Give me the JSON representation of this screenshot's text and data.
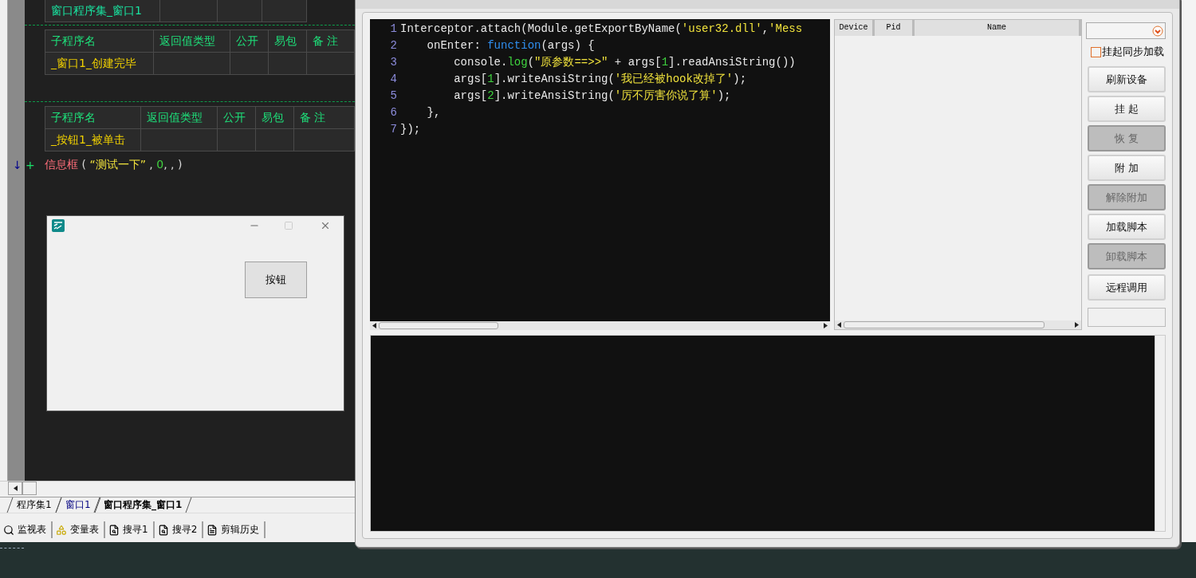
{
  "ide": {
    "module_table": {
      "name": "窗口程序集_窗口1"
    },
    "subroutines": [
      {
        "columns": [
          "子程序名",
          "返回值类型",
          "公开",
          "易包",
          "备 注"
        ],
        "name": "_窗口1_创建完毕"
      },
      {
        "columns": [
          "子程序名",
          "返回值类型",
          "公开",
          "易包",
          "备 注"
        ],
        "name": "_按钮1_被单击"
      }
    ],
    "line_marks": [
      {
        "kind": "arrow",
        "text": "↓"
      },
      {
        "kind": "plus",
        "text": "+"
      }
    ],
    "statement": [
      {
        "kind": "command",
        "text": "信息框"
      },
      {
        "kind": "punct",
        "text": " ( "
      },
      {
        "kind": "string",
        "text": "“测试一下”"
      },
      {
        "kind": "punct",
        "text": " , "
      },
      {
        "kind": "number",
        "text": "0"
      },
      {
        "kind": "punct",
        "text": ", , )"
      }
    ],
    "form_window": {
      "button": "按钮"
    },
    "doc_tabs": [
      {
        "label": "程序集1",
        "selected": false,
        "color": "#000000"
      },
      {
        "label": "窗口1",
        "selected": false,
        "color": "#000080"
      },
      {
        "label": "窗口程序集_窗口1",
        "selected": true,
        "color": "#000000"
      }
    ],
    "panel_tabs": [
      {
        "kind": "watch",
        "label": "监视表"
      },
      {
        "kind": "variables",
        "label": "变量表"
      },
      {
        "kind": "search",
        "label": "搜寻1"
      },
      {
        "kind": "search",
        "label": "搜寻2"
      },
      {
        "kind": "history",
        "label": "剪辑历史"
      }
    ]
  },
  "frida": {
    "code": [
      [
        {
          "kind": "plain",
          "text": "Interceptor.attach(Module.getExportByName("
        },
        {
          "kind": "string",
          "text": "'user32.dll'"
        },
        {
          "kind": "plain",
          "text": ","
        },
        {
          "kind": "string",
          "text": "'Mess"
        }
      ],
      [
        {
          "kind": "plain",
          "text": "    onEnter: "
        },
        {
          "kind": "keyword",
          "text": "function"
        },
        {
          "kind": "plain",
          "text": "(args) {"
        }
      ],
      [
        {
          "kind": "plain",
          "text": "        console."
        },
        {
          "kind": "call",
          "text": "log"
        },
        {
          "kind": "plain",
          "text": "("
        },
        {
          "kind": "string",
          "text": "\"原参数==>>\""
        },
        {
          "kind": "plain",
          "text": " + args["
        },
        {
          "kind": "number",
          "text": "1"
        },
        {
          "kind": "plain",
          "text": "].readAnsiString())"
        }
      ],
      [
        {
          "kind": "plain",
          "text": "        args["
        },
        {
          "kind": "number",
          "text": "1"
        },
        {
          "kind": "plain",
          "text": "].writeAnsiString("
        },
        {
          "kind": "string",
          "text": "'我已经被hook改掉了'"
        },
        {
          "kind": "plain",
          "text": ");"
        }
      ],
      [
        {
          "kind": "plain",
          "text": "        args["
        },
        {
          "kind": "number",
          "text": "2"
        },
        {
          "kind": "plain",
          "text": "].writeAnsiString("
        },
        {
          "kind": "string",
          "text": "'厉不厉害你说了算'"
        },
        {
          "kind": "plain",
          "text": ");"
        }
      ],
      [
        {
          "kind": "plain",
          "text": "    },"
        }
      ],
      [
        {
          "kind": "plain",
          "text": "});"
        }
      ]
    ],
    "line_numbers": [
      "1",
      "2",
      "3",
      "4",
      "5",
      "6",
      "7"
    ],
    "device_columns": [
      "Device",
      "Pid",
      "Name"
    ],
    "suspend_sync": {
      "label": "挂起同步加载",
      "checked": false
    },
    "buttons": [
      {
        "label": "刷新设备",
        "disabled": false
      },
      {
        "label": "挂 起",
        "disabled": false
      },
      {
        "label": "恢 复",
        "disabled": true
      },
      {
        "label": "附 加",
        "disabled": false
      },
      {
        "label": "解除附加",
        "disabled": true
      },
      {
        "label": "加载脚本",
        "disabled": false
      },
      {
        "label": "卸载脚本",
        "disabled": true
      },
      {
        "label": "远程调用",
        "disabled": false
      }
    ]
  }
}
